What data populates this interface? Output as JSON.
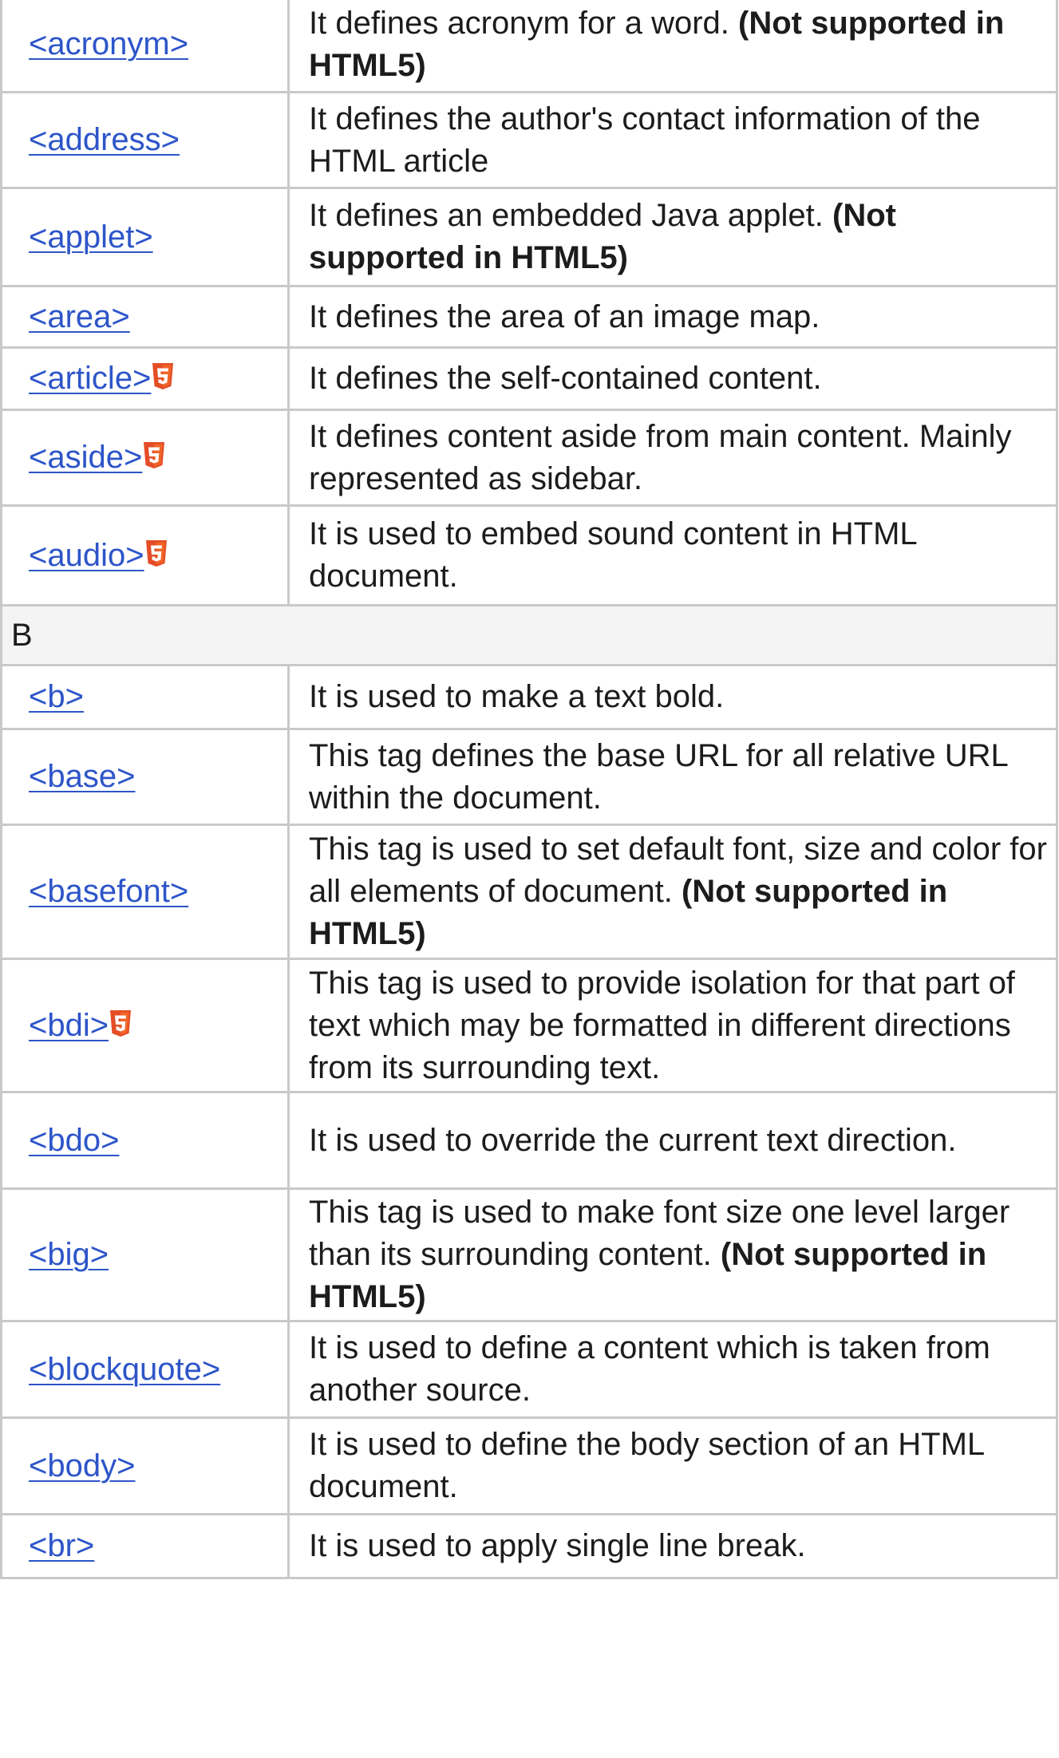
{
  "rows": [
    {
      "kind": "tag",
      "tag": "<acronym>",
      "html5": false,
      "text": "It defines acronym for a word.",
      "note": "(Not supported in HTML5)",
      "h": 120
    },
    {
      "kind": "tag",
      "tag": "<address>",
      "html5": false,
      "text": "It defines the author's contact information of the HTML article",
      "note": "",
      "h": 120
    },
    {
      "kind": "tag",
      "tag": "<applet>",
      "html5": false,
      "text": "It defines an embedded Java applet.",
      "note": "(Not supported in HTML5)",
      "h": 123
    },
    {
      "kind": "tag",
      "tag": "<area>",
      "html5": false,
      "text": "It defines the area of an image map.",
      "note": "",
      "h": 77
    },
    {
      "kind": "tag",
      "tag": "<article>",
      "html5": true,
      "text": "It defines the self-contained content.",
      "note": "",
      "h": 78
    },
    {
      "kind": "tag",
      "tag": "<aside>",
      "html5": true,
      "text": "It defines content aside from main content. Mainly represented as sidebar.",
      "note": "",
      "h": 120
    },
    {
      "kind": "tag",
      "tag": "<audio>",
      "html5": true,
      "text": "It is used to embed sound content in HTML document.",
      "note": "",
      "h": 125
    },
    {
      "kind": "section",
      "label": "B",
      "h": 75
    },
    {
      "kind": "tag",
      "tag": "<b>",
      "html5": false,
      "text": "It is used to make a text bold.",
      "note": "",
      "h": 80
    },
    {
      "kind": "tag",
      "tag": "<base>",
      "html5": false,
      "text": "This tag defines the base URL for all relative URL within the document.",
      "note": "",
      "h": 120
    },
    {
      "kind": "tag",
      "tag": "<basefont>",
      "html5": false,
      "text": "This tag is used to set default font, size and color for all elements of document.",
      "note": "(Not supported in HTML5)",
      "h": 168
    },
    {
      "kind": "tag",
      "tag": "<bdi>",
      "html5": true,
      "text": "This tag is used to provide isolation for that part of text which may be formatted in different directions from its surrounding text.",
      "note": "",
      "h": 167
    },
    {
      "kind": "tag",
      "tag": "<bdo>",
      "html5": false,
      "text": "It is used to override the current text direction.",
      "note": "",
      "h": 121
    },
    {
      "kind": "tag",
      "tag": "<big>",
      "html5": false,
      "text": "This tag is used to make font size one level larger than its surrounding content.",
      "note": "(Not supported in HTML5)",
      "h": 166
    },
    {
      "kind": "tag",
      "tag": "<blockquote>",
      "html5": false,
      "text": "It is used to define a content which is taken from another source.",
      "note": "",
      "h": 121
    },
    {
      "kind": "tag",
      "tag": "<body>",
      "html5": false,
      "text": "It is used to define the body section of an HTML document.",
      "note": "",
      "h": 121
    },
    {
      "kind": "tag",
      "tag": "<br>",
      "html5": false,
      "text": "It is used to apply single line break.",
      "note": "",
      "h": 80
    }
  ],
  "html5_badge": {
    "icon": "html5-icon",
    "color": "#e44d26",
    "shade": "#f16529"
  },
  "colors": {
    "link": "#2d55c9",
    "border": "#c9c9c9",
    "section_bg": "#f4f4f4",
    "text": "#1c1c1c"
  }
}
